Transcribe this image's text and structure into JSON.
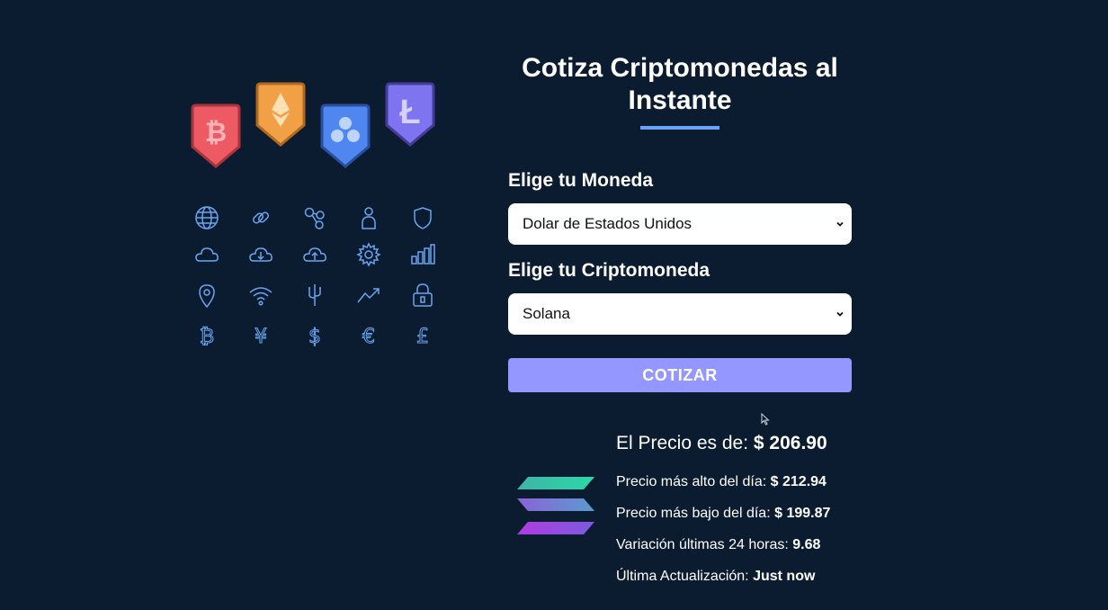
{
  "header": {
    "title": "Cotiza Criptomonedas al Instante"
  },
  "form": {
    "currency_label": "Elige tu Moneda",
    "currency_selected": "Dolar de Estados Unidos",
    "crypto_label": "Elige tu Criptomoneda",
    "crypto_selected": "Solana",
    "submit_label": "COTIZAR"
  },
  "result": {
    "price_label": "El Precio es de:",
    "price_value": "$ 206.90",
    "high_label": "Precio más alto del día:",
    "high_value": "$ 212.94",
    "low_label": "Precio más bajo del día:",
    "low_value": "$ 199.87",
    "change_label": "Variación últimas 24 horas:",
    "change_value": "9.68",
    "updated_label": "Última Actualización:",
    "updated_value": "Just now"
  },
  "illustration": {
    "badges": [
      "bitcoin-badge-icon",
      "ethereum-badge-icon",
      "ripple-badge-icon",
      "litecoin-badge-icon"
    ],
    "icons": [
      "globe-icon",
      "link-icon",
      "network-icon",
      "user-icon",
      "shield-icon",
      "cloud-icon",
      "cloud-download-icon",
      "cloud-upload-icon",
      "gear-icon",
      "bar-chart-icon",
      "location-pin-icon",
      "wifi-icon",
      "usb-icon",
      "trend-up-icon",
      "lock-icon",
      "bitcoin-icon",
      "yen-icon",
      "dollar-icon",
      "euro-icon",
      "pound-icon"
    ]
  },
  "colors": {
    "background": "#0c1c30",
    "accent": "#66a2fe",
    "button": "#9497ff",
    "icon_stroke": "#6aa5f0"
  }
}
